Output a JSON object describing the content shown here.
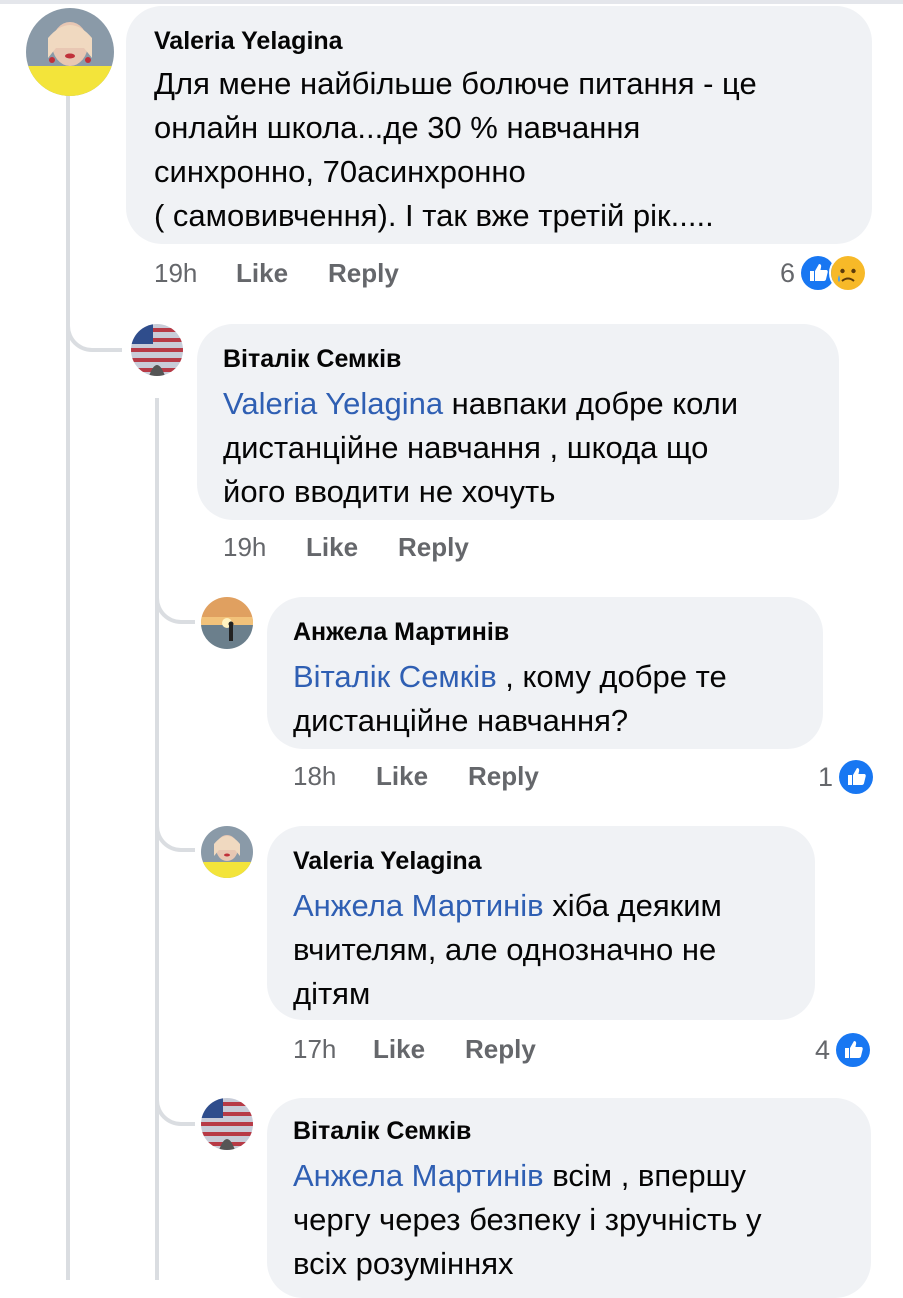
{
  "comments": [
    {
      "author": "Valeria Yelagina",
      "mention": "",
      "text_lines": [
        "Для мене найбільше болюче питання - це",
        "онлайн школа...де 30 % навчання",
        "синхронно, 70асинхронно",
        "( самовивчення). І так вже третій рік....."
      ],
      "time": "19h",
      "like": "Like",
      "reply": "Reply",
      "reaction_count": "6",
      "reactions": [
        "like-icon",
        "sad-icon"
      ]
    },
    {
      "author": "Віталік Семків",
      "mention": "Valeria Yelagina",
      "text_lines": [
        " навпаки добре коли",
        "дистанційне навчання , шкода що",
        "його вводити не хочуть"
      ],
      "time": "19h",
      "like": "Like",
      "reply": "Reply",
      "reaction_count": "",
      "reactions": []
    },
    {
      "author": "Анжела Мартинів",
      "mention": "Віталік Семків",
      "text_lines": [
        " , кому добре те",
        "дистанційне навчання?"
      ],
      "time": "18h",
      "like": "Like",
      "reply": "Reply",
      "reaction_count": "1",
      "reactions": [
        "like-icon"
      ]
    },
    {
      "author": "Valeria Yelagina",
      "mention": "Анжела Мартинів",
      "text_lines": [
        " хіба деяким",
        "вчителям, але однозначно не",
        "дітям"
      ],
      "time": "17h",
      "like": "Like",
      "reply": "Reply",
      "reaction_count": "4",
      "reactions": [
        "like-icon"
      ]
    },
    {
      "author": "Віталік Семків",
      "mention": "Анжела Мартинів",
      "text_lines": [
        " всім , впершу",
        "чергу через безпеку і зручність у",
        "всіх розуміннях"
      ],
      "time": "",
      "like": "",
      "reply": "",
      "reaction_count": "",
      "reactions": []
    }
  ],
  "colors": {
    "bubble": "#f0f2f5",
    "mention": "#2f5fb3",
    "meta": "#65676b",
    "like_blue": "#1877f2",
    "sad_yellow": "#f7b928",
    "thread_line": "#dadde1"
  }
}
